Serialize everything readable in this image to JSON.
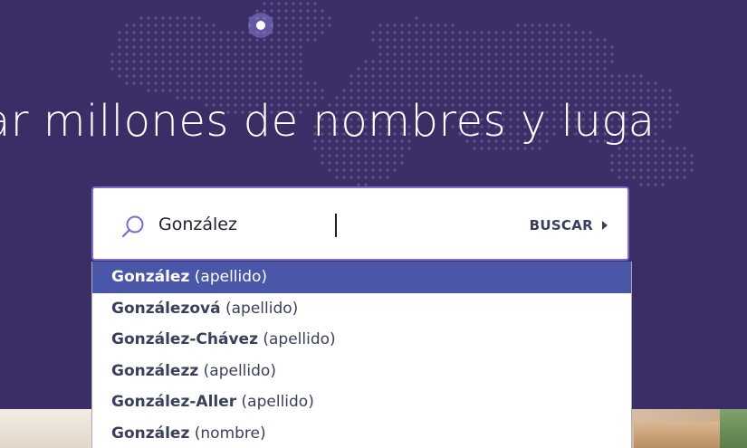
{
  "colors": {
    "hero_background": "#3b2d66",
    "search_border": "#7d6bd4",
    "dropdown_active_bg": "#4a56a8",
    "text_dark": "#3a3f5c",
    "map_dots": "#5a4d8a",
    "map_highlight": "#9a8cf0"
  },
  "hero": {
    "headline": "car millones de nombres y luga"
  },
  "search": {
    "value": "González",
    "icon": "search-icon",
    "button_label": "BUSCAR",
    "button_icon": "caret-right-icon"
  },
  "suggestions": [
    {
      "name": "González",
      "type": "(apellido)",
      "active": true
    },
    {
      "name": "Gonzálezová",
      "type": "(apellido)",
      "active": false
    },
    {
      "name": "González-Chávez",
      "type": "(apellido)",
      "active": false
    },
    {
      "name": "Gonzálezz",
      "type": "(apellido)",
      "active": false
    },
    {
      "name": "González-Aller",
      "type": "(apellido)",
      "active": false
    },
    {
      "name": "González",
      "type": "(nombre)",
      "active": false
    }
  ]
}
